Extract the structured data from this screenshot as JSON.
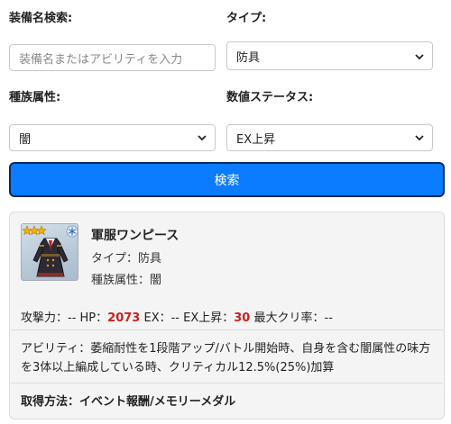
{
  "search_form": {
    "name_label": "装備名検索:",
    "name_placeholder": "装備名またはアビリティを入力",
    "type_label": "タイプ:",
    "type_value": "防具",
    "race_label": "種族属性:",
    "race_value": "闇",
    "stat_label": "数値ステータス:",
    "stat_value": "EX上昇",
    "search_button": "検索"
  },
  "result": {
    "rarity_stars": 3,
    "name": "軍服ワンピース",
    "type_line": "タイプ：防具",
    "race_line": "種族属性：闇",
    "stats": {
      "attack_label": "攻撃力：--",
      "hp_label": "HP：",
      "hp_value": "2073",
      "ex_label": "EX：--",
      "exup_label": "EX上昇：",
      "exup_value": "30",
      "crit_label": "最大クリ率：--"
    },
    "ability": "アビリティ：萎縮耐性を1段階アップ/バトル開始時、自身を含む闇属性の味方を3体以上編成している時、クリティカル12.5%(25%)加算",
    "acquisition": "取得方法：イベント報酬/メモリーメダル"
  },
  "colors": {
    "accent": "#0b7bff",
    "highlight": "#cc1f1f",
    "star": "#f2b200"
  },
  "icons": [
    "chevron-down-icon",
    "star-icon",
    "snowflake-icon"
  ]
}
